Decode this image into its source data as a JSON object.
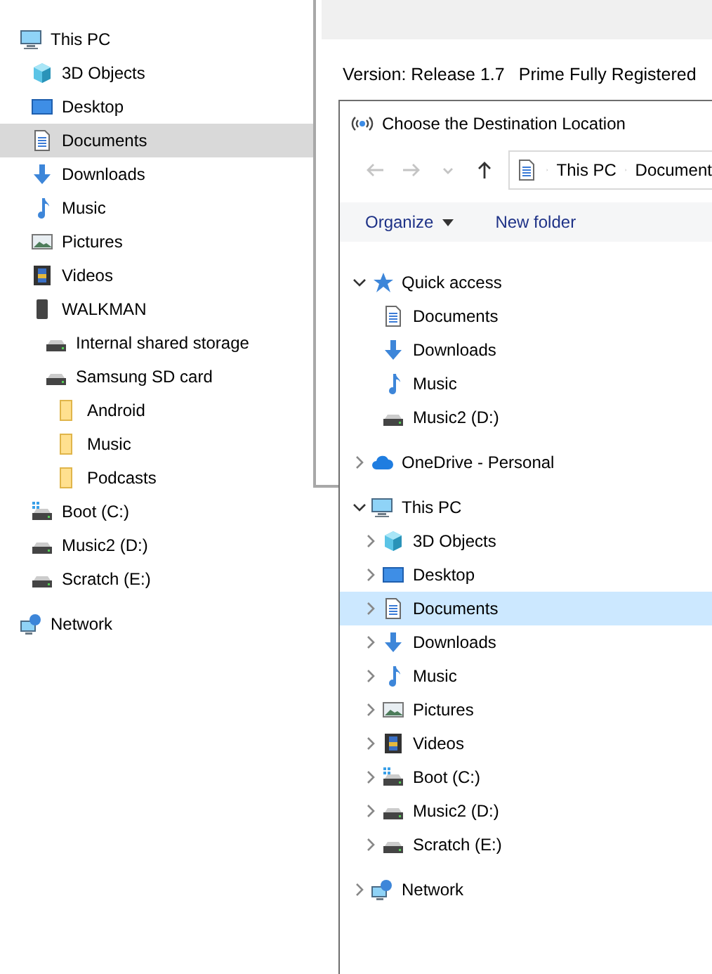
{
  "background_window": {
    "version_text": "Version: Release 1.7",
    "license_text": "Prime Fully Registered"
  },
  "left_pane": {
    "items": [
      {
        "label": "This PC",
        "kind": "computer",
        "selected": false,
        "children": [
          {
            "label": "3D Objects",
            "kind": "cube",
            "selected": false
          },
          {
            "label": "Desktop",
            "kind": "desktop",
            "selected": false
          },
          {
            "label": "Documents",
            "kind": "document",
            "selected": true
          },
          {
            "label": "Downloads",
            "kind": "download",
            "selected": false
          },
          {
            "label": "Music",
            "kind": "music",
            "selected": false
          },
          {
            "label": "Pictures",
            "kind": "pictures",
            "selected": false
          },
          {
            "label": "Videos",
            "kind": "videos",
            "selected": false
          },
          {
            "label": "WALKMAN",
            "kind": "phone",
            "selected": false,
            "children": [
              {
                "label": "Internal shared storage",
                "kind": "drive",
                "selected": false
              },
              {
                "label": "Samsung SD card",
                "kind": "drive",
                "selected": false,
                "children": [
                  {
                    "label": "Android",
                    "kind": "folder",
                    "selected": false
                  },
                  {
                    "label": "Music",
                    "kind": "folder",
                    "selected": false
                  },
                  {
                    "label": "Podcasts",
                    "kind": "folder",
                    "selected": false
                  }
                ]
              }
            ]
          },
          {
            "label": "Boot (C:)",
            "kind": "boot",
            "selected": false
          },
          {
            "label": "Music2 (D:)",
            "kind": "drive",
            "selected": false
          },
          {
            "label": "Scratch (E:)",
            "kind": "drive",
            "selected": false
          }
        ]
      },
      {
        "label": "Network",
        "kind": "network",
        "selected": false
      }
    ]
  },
  "dialog": {
    "title": "Choose the Destination Location",
    "navigation": {
      "back_disabled": true,
      "forward_disabled": true
    },
    "address": [
      "This PC",
      "Document"
    ],
    "toolbar": [
      {
        "label": "Organize",
        "dropdown": true
      },
      {
        "label": "New folder",
        "dropdown": false
      }
    ],
    "tree": [
      {
        "label": "Quick access",
        "kind": "star",
        "selected": false,
        "expanded": true,
        "children": [
          {
            "label": "Documents",
            "kind": "document",
            "selected": false
          },
          {
            "label": "Downloads",
            "kind": "download",
            "selected": false
          },
          {
            "label": "Music",
            "kind": "music",
            "selected": false
          },
          {
            "label": "Music2 (D:)",
            "kind": "drive",
            "selected": false
          }
        ]
      },
      {
        "label": "OneDrive - Personal",
        "kind": "cloud",
        "selected": false,
        "expanded": false
      },
      {
        "label": "This PC",
        "kind": "computer",
        "selected": false,
        "expanded": true,
        "children": [
          {
            "label": "3D Objects",
            "kind": "cube",
            "selected": false,
            "expanded": false
          },
          {
            "label": "Desktop",
            "kind": "desktop",
            "selected": false,
            "expanded": false
          },
          {
            "label": "Documents",
            "kind": "document",
            "selected": true,
            "expanded": false
          },
          {
            "label": "Downloads",
            "kind": "download",
            "selected": false,
            "expanded": false
          },
          {
            "label": "Music",
            "kind": "music",
            "selected": false,
            "expanded": false
          },
          {
            "label": "Pictures",
            "kind": "pictures",
            "selected": false,
            "expanded": false
          },
          {
            "label": "Videos",
            "kind": "videos",
            "selected": false,
            "expanded": false
          },
          {
            "label": "Boot (C:)",
            "kind": "boot",
            "selected": false,
            "expanded": false
          },
          {
            "label": "Music2 (D:)",
            "kind": "drive",
            "selected": false,
            "expanded": false
          },
          {
            "label": "Scratch (E:)",
            "kind": "drive",
            "selected": false,
            "expanded": false
          }
        ]
      },
      {
        "label": "Network",
        "kind": "network",
        "selected": false,
        "expanded": false
      }
    ]
  }
}
